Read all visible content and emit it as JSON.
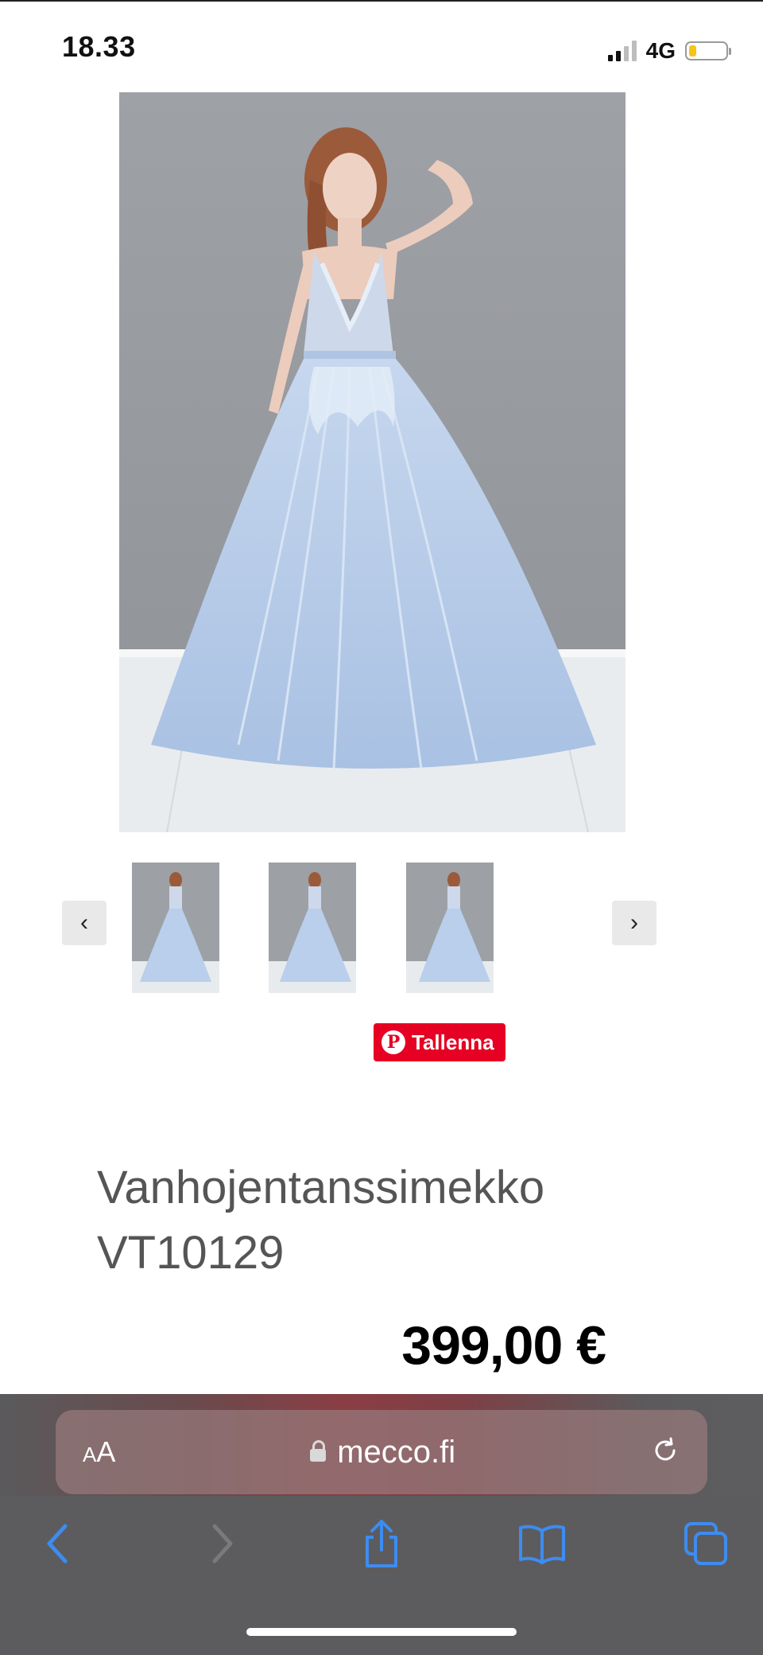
{
  "status_bar": {
    "time": "18.33",
    "network": "4G",
    "battery_color": "#f5c518",
    "battery_level": 0.2,
    "signal_bars_active": 2,
    "signal_bars_total": 4
  },
  "product": {
    "title": "Vanhojentanssimekko VT10129",
    "price": "399,00 €",
    "dress_color": "#b9d0ec",
    "thumbnail_count": 3
  },
  "carousel": {
    "prev_icon": "chevron-left-icon",
    "next_icon": "chevron-right-icon",
    "prev_glyph": "‹",
    "next_glyph": "›"
  },
  "pinterest": {
    "label": "Tallenna",
    "color": "#e60023",
    "logo_glyph": "P"
  },
  "browser": {
    "text_size_label_small": "A",
    "text_size_label_large": "A",
    "url": "mecco.fi",
    "accent": "#3d8cf0"
  }
}
